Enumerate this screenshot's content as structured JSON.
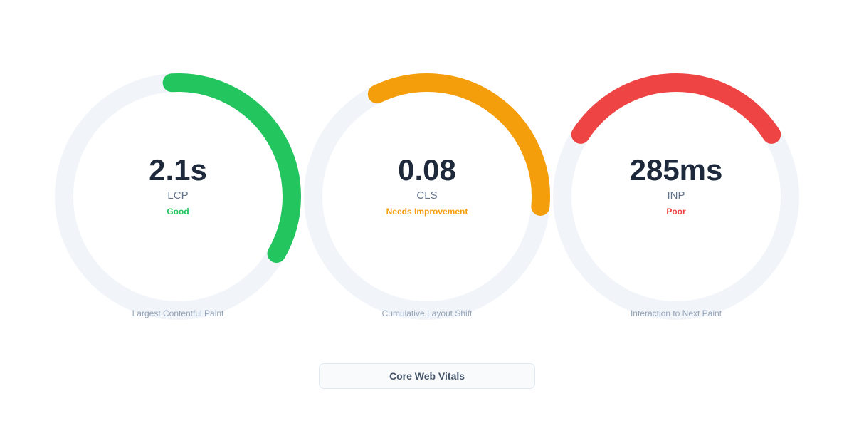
{
  "colors": {
    "good": "#22c55e",
    "needs_improvement": "#f59e0b",
    "poor": "#ef4444",
    "track": "#f1f5f9"
  },
  "metrics": [
    {
      "value": "2.1s",
      "abbr": "LCP",
      "status": "Good",
      "status_key": "good",
      "full_name": "Largest Contentful Paint",
      "fill_start_deg": 357,
      "fill_end_deg": 120
    },
    {
      "value": "0.08",
      "abbr": "CLS",
      "status": "Needs Improvement",
      "status_key": "needs_improvement",
      "full_name": "Cumulative Layout Shift",
      "fill_start_deg": 334,
      "fill_end_deg": 95
    },
    {
      "value": "285ms",
      "abbr": "INP",
      "status": "Poor",
      "status_key": "poor",
      "full_name": "Interaction to Next Paint",
      "fill_start_deg": 303,
      "fill_end_deg": 57
    }
  ],
  "footer": {
    "label": "Core Web Vitals"
  }
}
